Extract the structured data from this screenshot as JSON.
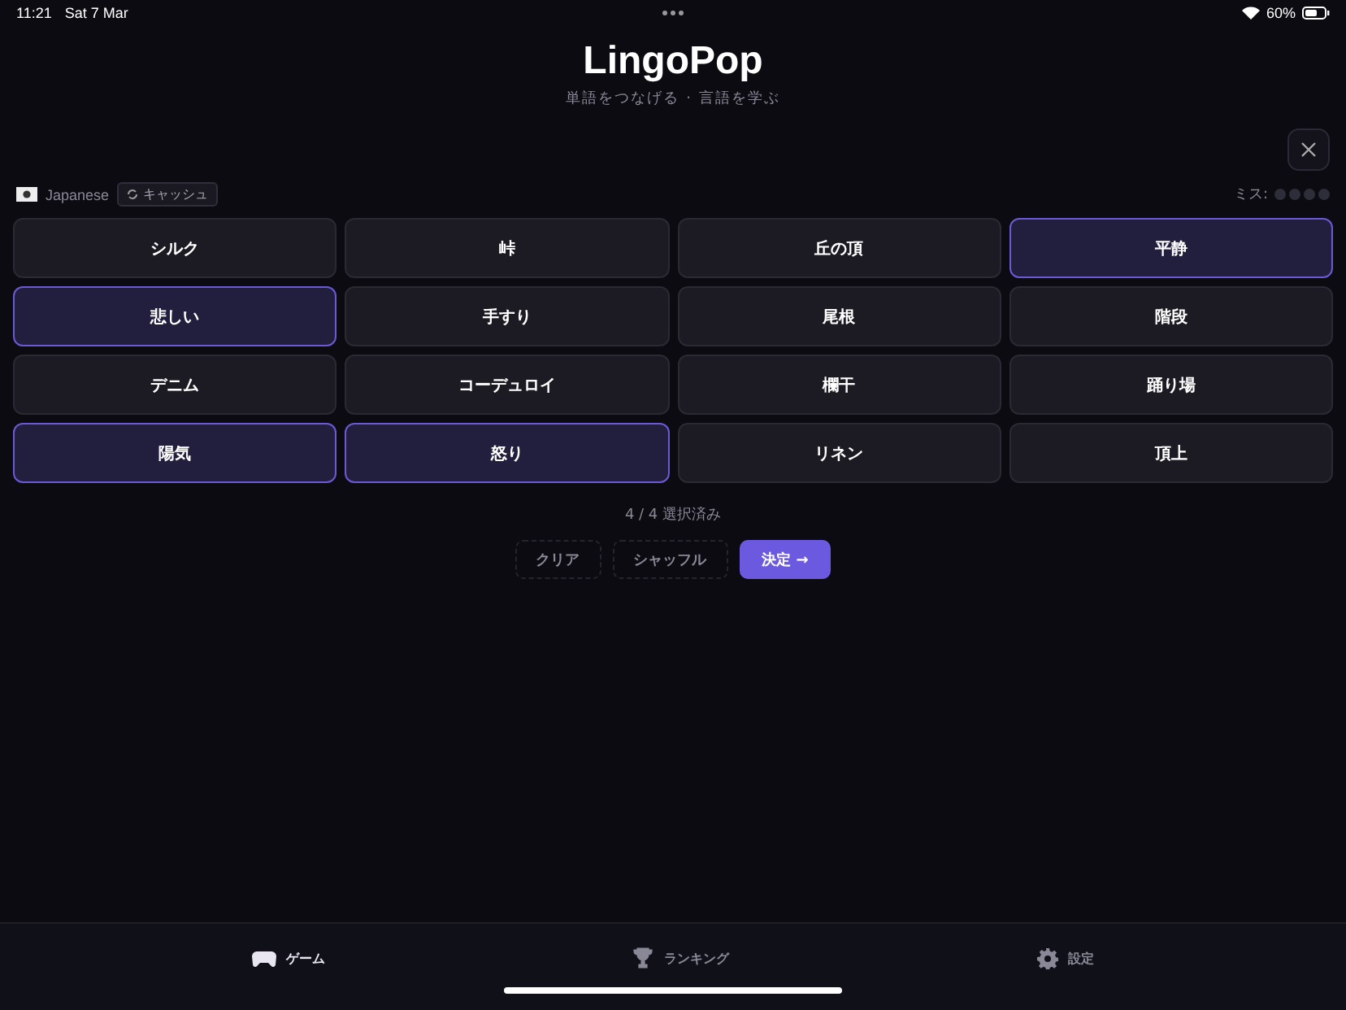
{
  "status_bar": {
    "time": "11:21",
    "date": "Sat 7 Mar",
    "battery": "60%"
  },
  "header": {
    "title": "LingoPop",
    "subtitle": "単語をつなげる · 言語を学ぶ"
  },
  "language": {
    "name": "Japanese",
    "cache_badge": "キャッシュ"
  },
  "mistakes": {
    "label": "ミス:",
    "dots": [
      {
        "used": false
      },
      {
        "used": false
      },
      {
        "used": false
      },
      {
        "used": false
      }
    ]
  },
  "tiles": [
    {
      "label": "シルク",
      "selected": false
    },
    {
      "label": "峠",
      "selected": false
    },
    {
      "label": "丘の頂",
      "selected": false
    },
    {
      "label": "平静",
      "selected": true
    },
    {
      "label": "悲しい",
      "selected": true
    },
    {
      "label": "手すり",
      "selected": false
    },
    {
      "label": "尾根",
      "selected": false
    },
    {
      "label": "階段",
      "selected": false
    },
    {
      "label": "デニム",
      "selected": false
    },
    {
      "label": "コーデュロイ",
      "selected": false
    },
    {
      "label": "欄干",
      "selected": false
    },
    {
      "label": "踊り場",
      "selected": false
    },
    {
      "label": "陽気",
      "selected": true
    },
    {
      "label": "怒り",
      "selected": true
    },
    {
      "label": "リネン",
      "selected": false
    },
    {
      "label": "頂上",
      "selected": false
    }
  ],
  "selection_count": "4 / 4 選択済み",
  "actions": [
    {
      "label": "クリア",
      "kind": "secondary"
    },
    {
      "label": "シャッフル",
      "kind": "secondary"
    },
    {
      "label": "決定 →",
      "kind": "primary"
    }
  ],
  "tab_bar": [
    {
      "label": "ゲーム",
      "kind": "gamepad",
      "selected": true
    },
    {
      "label": "ランキング",
      "kind": "trophy",
      "selected": false
    },
    {
      "label": "設定",
      "kind": "gear",
      "selected": false
    }
  ]
}
